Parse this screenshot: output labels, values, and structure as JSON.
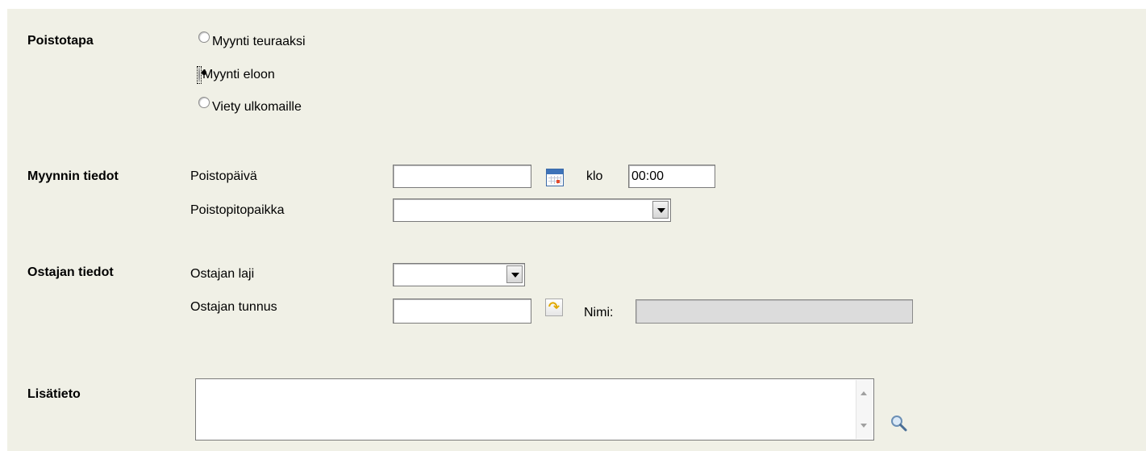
{
  "removal_method": {
    "label": "Poistotapa",
    "options": [
      {
        "label": "Myynti teuraaksi",
        "checked": false
      },
      {
        "label": "Myynti eloon",
        "checked": true
      },
      {
        "label": "Viety ulkomaille",
        "checked": false
      }
    ]
  },
  "sale_info": {
    "label": "Myynnin tiedot",
    "date_label": "Poistopäivä",
    "date_value": "",
    "time_label": "klo",
    "time_value": "00:00",
    "location_label": "Poistopitopaikka",
    "location_value": ""
  },
  "buyer_info": {
    "label": "Ostajan tiedot",
    "type_label": "Ostajan laji",
    "type_value": "",
    "id_label": "Ostajan tunnus",
    "id_value": "",
    "name_label": "Nimi:",
    "name_value": ""
  },
  "extra": {
    "label": "Lisätieto",
    "value": ""
  },
  "icons": {
    "calendar": "calendar-icon",
    "lookup": "lookup-arrow-icon",
    "search": "magnifier-search-icon"
  },
  "colors": {
    "panel_bg": "#f0f0e6",
    "disabled_bg": "#dcdcdc"
  }
}
